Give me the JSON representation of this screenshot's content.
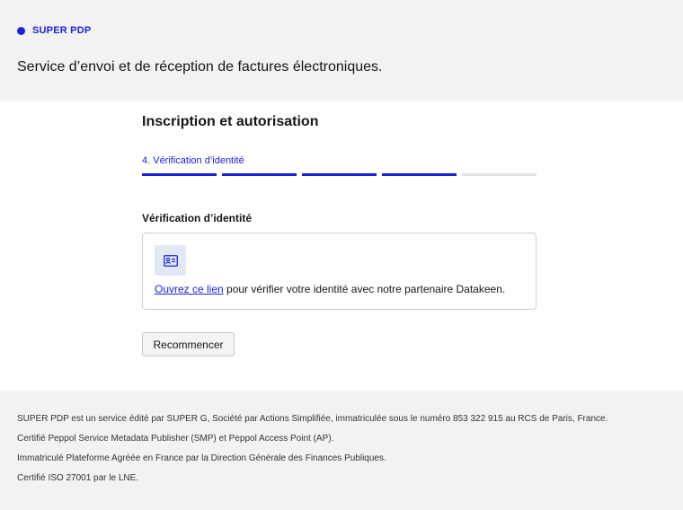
{
  "header": {
    "brand_name": "SUPER PDP",
    "tagline": "Service d’envoi et de réception de factures électroniques."
  },
  "main": {
    "title": "Inscription et autorisation",
    "step_label": "4. Vérification d’identité",
    "progress": {
      "current_step": 4,
      "total_steps": 5
    },
    "section_title": "Vérification d’identité",
    "card": {
      "icon": "id-card-icon",
      "link_text": "Ouvrez ce lien",
      "text_after_link": " pour vérifier votre identité avec notre partenaire Datakeen."
    },
    "restart_label": "Recommencer"
  },
  "footer": {
    "lines": [
      "SUPER PDP est un service édité par SUPER G, Société par Actions Simplifiée, immatriculée sous le numéro 853 322 915 au RCS de Paris, France.",
      "Certifié Peppol Service Metadata Publisher (SMP) et Peppol Access Point (AP).",
      "Immatriculé Plateforme Agréée en France par la Direction Générale des Finances Publiques.",
      "Certifié ISO 27001 par le LNE."
    ]
  },
  "colors": {
    "accent": "#1b22dc",
    "band_background": "#f2f2f2",
    "icon_tile": "#e3e8f7",
    "progress_inactive": "#e4e4e4"
  }
}
